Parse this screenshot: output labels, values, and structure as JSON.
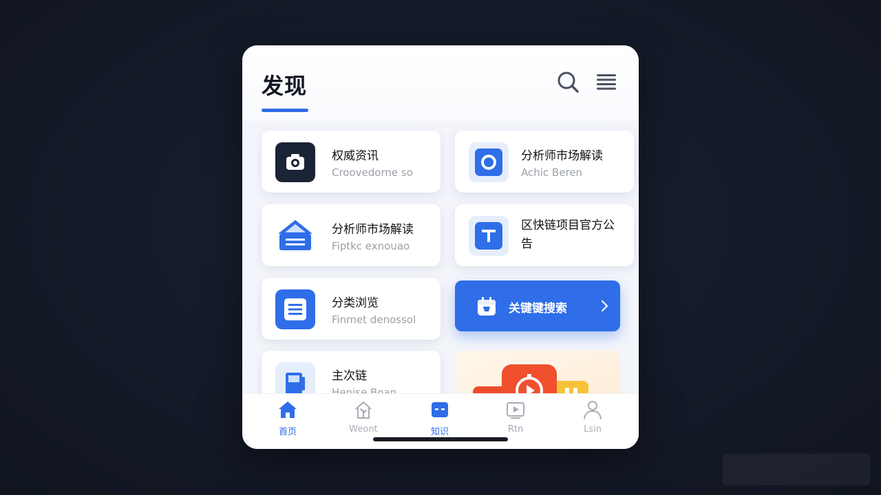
{
  "header": {
    "title": "发现"
  },
  "icons": {
    "search": "search-icon",
    "menu": "menu-icon"
  },
  "colors": {
    "accent": "#2f6ee8",
    "dark_icon": "#1b2436",
    "text": "#111111",
    "muted": "#9aa0a8"
  },
  "cards": [
    {
      "title": "权威资讯",
      "subtitle": "Croovedorne so",
      "icon": "camera-icon"
    },
    {
      "title": "分析师市场解读",
      "subtitle": "Achic Beren",
      "icon": "circle-icon"
    },
    {
      "title": "分析师市场解读",
      "subtitle": "Fiptkc exnouao",
      "icon": "house-icon"
    },
    {
      "title": "区快链项目官方公告",
      "subtitle": "",
      "icon": "text-icon"
    },
    {
      "title": "分类浏览",
      "subtitle": "Finmet denossol",
      "icon": "list-icon"
    },
    {
      "title": "主次链",
      "subtitle": "Henise Boan",
      "icon": "bottle-icon"
    }
  ],
  "cta": {
    "label": "关键键搜索",
    "icon": "calendar-icon",
    "chevron": "chevron-right-icon"
  },
  "tabs": [
    {
      "label": "首页",
      "icon": "home-icon",
      "active": true
    },
    {
      "label": "Weont",
      "icon": "tree-icon",
      "active": false
    },
    {
      "label": "知识",
      "icon": "book-icon",
      "active": true
    },
    {
      "label": "Rtn",
      "icon": "play-icon",
      "active": false
    },
    {
      "label": "Lsin",
      "icon": "user-icon",
      "active": false
    }
  ]
}
